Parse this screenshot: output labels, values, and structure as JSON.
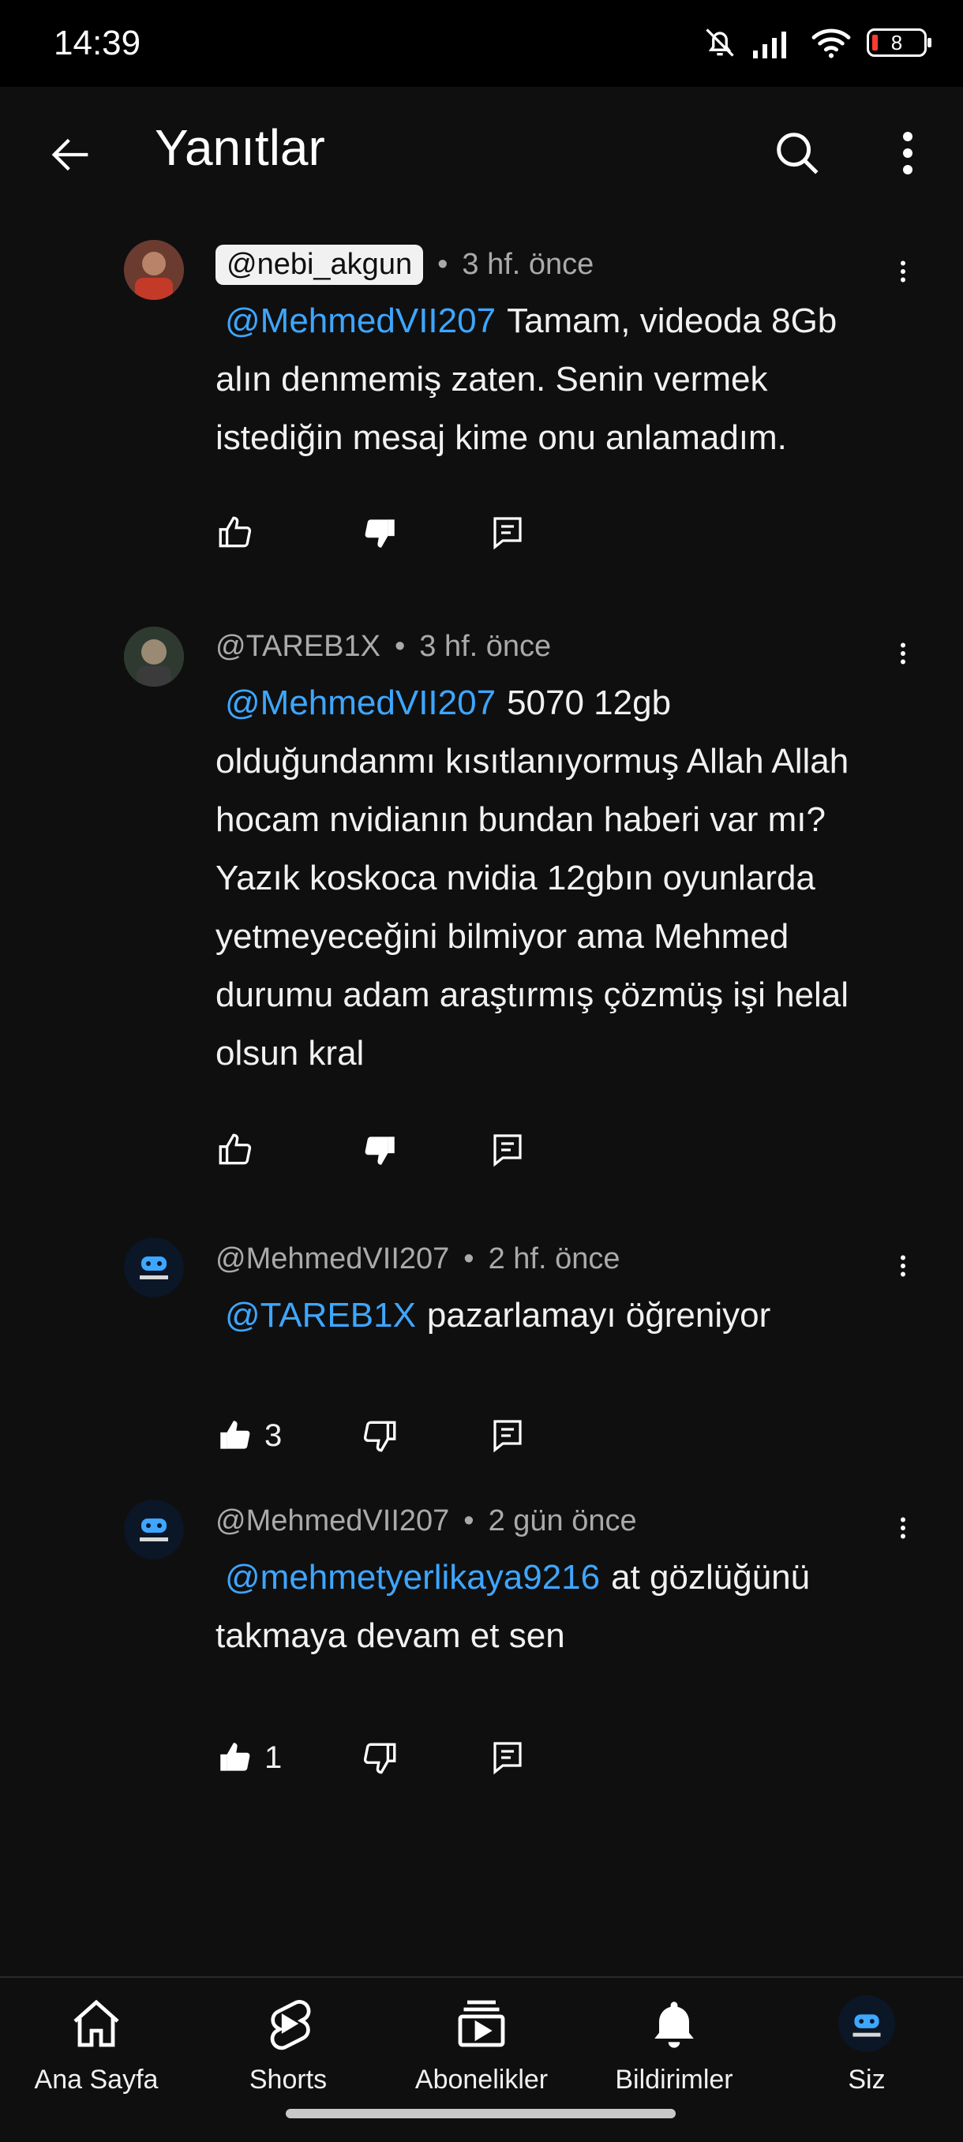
{
  "status_bar": {
    "time": "14:39",
    "battery": "8"
  },
  "header": {
    "title": "Yanıtlar"
  },
  "comments": [
    {
      "handle": "@nebi_akgun",
      "time": "3 hf. önce",
      "mention": "@MehmedVII207",
      "text": "Tamam, videoda 8Gb alın denmemiş zaten. Senin vermek istediğin mesaj kime onu anlamadım.",
      "likes": ""
    },
    {
      "handle": "@TAREB1X",
      "time": "3 hf. önce",
      "mention": "@MehmedVII207",
      "text": "5070 12gb olduğundanmı kısıtlanıyormuş Allah Allah hocam nvidianın bundan haberi var mı? Yazık koskoca nvidia 12gbın oyunlarda yetmeyeceğini bilmiyor ama Mehmed durumu adam araştırmış çözmüş işi helal olsun kral",
      "likes": ""
    },
    {
      "handle": "@MehmedVII207",
      "time": "2 hf. önce",
      "mention": "@TAREB1X",
      "text": "pazarlamayı öğreniyor",
      "likes": "3"
    },
    {
      "handle": "@MehmedVII207",
      "time": "2 gün önce",
      "mention": "@mehmetyerlikaya9216",
      "text": "at gözlüğünü takmaya devam et sen",
      "likes": "1"
    }
  ],
  "nav": {
    "home": "Ana Sayfa",
    "shorts": "Shorts",
    "subscriptions": "Abonelikler",
    "notifications": "Bildirimler",
    "you": "Siz"
  },
  "colors": {
    "background": "#0f0f0f",
    "mention": "#3ea6ff",
    "meta": "#aaaaaa"
  }
}
